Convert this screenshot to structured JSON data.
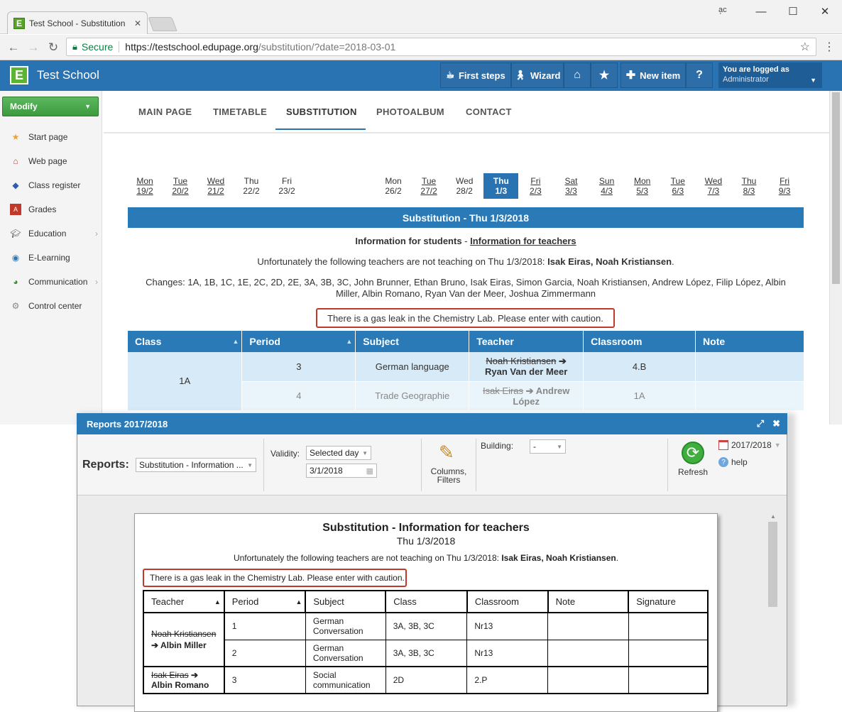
{
  "browser": {
    "tab_title": "Test School - Substitution",
    "secure_label": "Secure",
    "url_scheme_host": "https://testschool.edupage.org",
    "url_path": "/substitution/?date=2018-03-01",
    "window_controls": [
      "minimize-icon",
      "maximize-icon",
      "close-icon"
    ]
  },
  "header": {
    "site_name": "Test School",
    "first_steps": "First steps",
    "wizard": "Wizard",
    "new_item": "New item",
    "help": "?",
    "login_line1": "You are logged as",
    "login_line2": "Administrator"
  },
  "sidebar": {
    "modify": "Modify",
    "items": [
      {
        "label": "Start page",
        "icon": "star-icon"
      },
      {
        "label": "Web page",
        "icon": "house-icon"
      },
      {
        "label": "Class register",
        "icon": "book-icon"
      },
      {
        "label": "Grades",
        "icon": "grades-icon"
      },
      {
        "label": "Education",
        "icon": "graduation-icon"
      },
      {
        "label": "E-Learning",
        "icon": "globe-icon"
      },
      {
        "label": "Communication",
        "icon": "chat-icon"
      },
      {
        "label": "Control center",
        "icon": "gear-icon"
      }
    ]
  },
  "nav": {
    "tabs": [
      "MAIN PAGE",
      "TIMETABLE",
      "SUBSTITUTION",
      "PHOTOALBUM",
      "CONTACT"
    ],
    "active": "SUBSTITUTION"
  },
  "days_week1": [
    {
      "d": "Mon",
      "n": "19/2",
      "link": true
    },
    {
      "d": "Tue",
      "n": "20/2",
      "link": true
    },
    {
      "d": "Wed",
      "n": "21/2",
      "link": true
    },
    {
      "d": "Thu",
      "n": "22/2",
      "link": false
    },
    {
      "d": "Fri",
      "n": "23/2",
      "link": false
    }
  ],
  "days_week2": [
    {
      "d": "Mon",
      "n": "26/2",
      "link": false
    },
    {
      "d": "Tue",
      "n": "27/2",
      "link": true
    },
    {
      "d": "Wed",
      "n": "28/2",
      "link": false
    },
    {
      "d": "Thu",
      "n": "1/3",
      "link": false,
      "active": true
    },
    {
      "d": "Fri",
      "n": "2/3",
      "link": true
    },
    {
      "d": "Sat",
      "n": "3/3",
      "link": true
    },
    {
      "d": "Sun",
      "n": "4/3",
      "link": true
    },
    {
      "d": "Mon",
      "n": "5/3",
      "link": true
    },
    {
      "d": "Tue",
      "n": "6/3",
      "link": true
    },
    {
      "d": "Wed",
      "n": "7/3",
      "link": true
    },
    {
      "d": "Thu",
      "n": "8/3",
      "link": true
    },
    {
      "d": "Fri",
      "n": "9/3",
      "link": true
    }
  ],
  "substitution": {
    "bar_title": "Substitution - Thu 1/3/2018",
    "info_students": "Information for students",
    "info_sep": " - ",
    "info_teachers": "Information for teachers",
    "absent_prefix": "Unfortunately the following teachers are not teaching on Thu 1/3/2018: ",
    "absent_names": "Isak Eiras, Noah Kristiansen",
    "absent_suffix": ".",
    "changes": "Changes: 1A, 1B, 1C, 1E, 2C, 2D, 2E, 3A, 3B, 3C, John Brunner, Ethan Bruno, Isak Eiras, Simon Garcia, Noah Kristiansen, Andrew López, Filip López, Albin Miller, Albin Romano, Ryan Van der Meer, Joshua Zimmermann",
    "notice": "There is a gas leak in the Chemistry Lab. Please enter with caution."
  },
  "main_table": {
    "headers": [
      "Class",
      "Period",
      "Subject",
      "Teacher",
      "Classroom",
      "Note"
    ],
    "class_cell": "1A",
    "rows": [
      {
        "period": "3",
        "subject": "German language",
        "teacher_old": "Noah Kristiansen",
        "arrow": " ➔ ",
        "teacher_new": "Ryan Van der Meer",
        "classroom": "4.B",
        "note": ""
      },
      {
        "period": "4",
        "subject": "Trade Geographie",
        "teacher_old": "Isak Eiras",
        "arrow": " ➔ ",
        "teacher_new": "Andrew López",
        "classroom": "1A",
        "note": ""
      }
    ]
  },
  "reports": {
    "title": "Reports 2017/2018",
    "reports_label": "Reports:",
    "report_select": "Substitution - Information ...",
    "validity_label": "Validity:",
    "validity_select": "Selected day",
    "date_value": "3/1/2018",
    "columns_label": "Columns, Filters",
    "building_label": "Building:",
    "building_select": "-",
    "refresh": "Refresh",
    "year": "2017/2018",
    "help": "help"
  },
  "report_doc": {
    "title": "Substitution - Information for teachers",
    "date": "Thu 1/3/2018",
    "absent_prefix": "Unfortunately the following teachers are not teaching on Thu 1/3/2018: ",
    "absent_names": "Isak Eiras, Noah Kristiansen",
    "absent_suffix": ".",
    "notice": "There is a gas leak in the Chemistry Lab. Please enter with caution.",
    "headers": [
      "Teacher",
      "Period",
      "Subject",
      "Class",
      "Classroom",
      "Note",
      "Signature"
    ],
    "groups": [
      {
        "teacher_old": "Noah Kristiansen",
        "teacher_new": "Albin Miller",
        "rows": [
          {
            "period": "1",
            "subject": "German Conversation",
            "class": "3A, 3B, 3C",
            "classroom": "Nr13"
          },
          {
            "period": "2",
            "subject": "German Conversation",
            "class": "3A, 3B, 3C",
            "classroom": "Nr13"
          }
        ]
      },
      {
        "teacher_old": "Isak Eiras",
        "teacher_new": "Albin Romano",
        "rows": [
          {
            "period": "3",
            "subject": "Social communication",
            "class": "2D",
            "classroom": "2.P"
          }
        ]
      }
    ]
  }
}
